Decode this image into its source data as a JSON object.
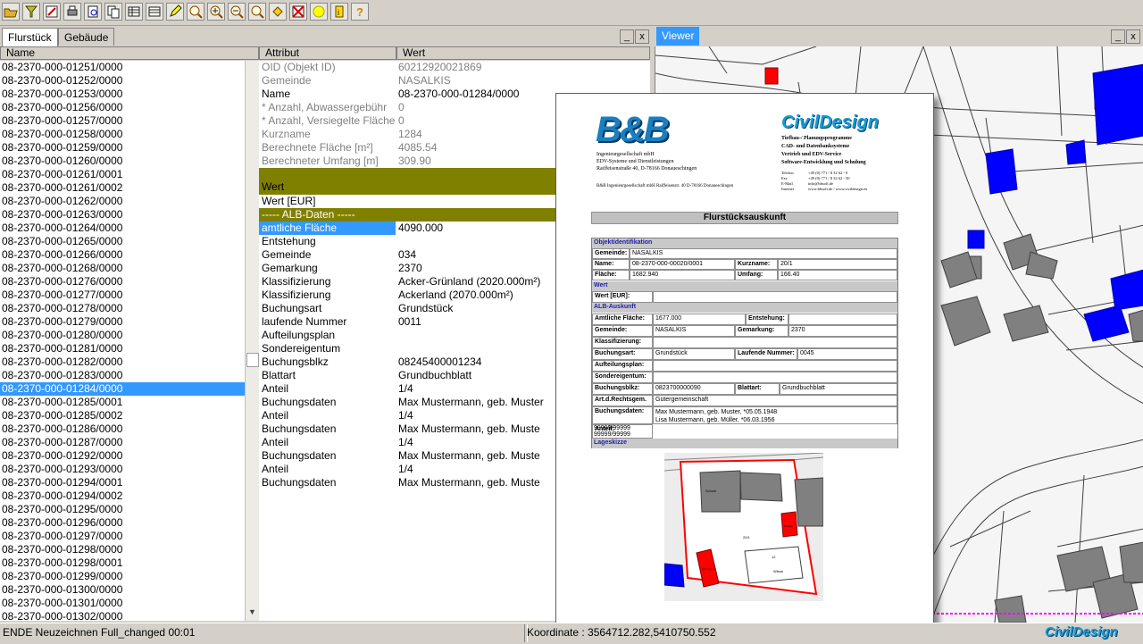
{
  "toolbar": {
    "icons": [
      "open-folder-icon",
      "filter-icon",
      "map-edit-icon",
      "printer-icon",
      "print-preview-icon",
      "copy-icon",
      "table-icon",
      "table-edit-icon",
      "pen-edit-icon",
      "zoom-window-icon",
      "zoom-in-icon",
      "zoom-out-icon",
      "zoom-previous-icon",
      "pan-icon",
      "delete-selection-icon",
      "highlight-icon",
      "info-icon",
      "help-icon"
    ]
  },
  "left_panel": {
    "tabs": [
      "Flurstück",
      "Gebäude"
    ],
    "columns": {
      "name": "Name",
      "attribute": "Attribut",
      "value": "Wert"
    },
    "min_btn": "_",
    "close_btn": "x",
    "items": [
      "08-2370-000-01251/0000",
      "08-2370-000-01252/0000",
      "08-2370-000-01253/0000",
      "08-2370-000-01256/0000",
      "08-2370-000-01257/0000",
      "08-2370-000-01258/0000",
      "08-2370-000-01259/0000",
      "08-2370-000-01260/0000",
      "08-2370-000-01261/0001",
      "08-2370-000-01261/0002",
      "08-2370-000-01262/0000",
      "08-2370-000-01263/0000",
      "08-2370-000-01264/0000",
      "08-2370-000-01265/0000",
      "08-2370-000-01266/0000",
      "08-2370-000-01268/0000",
      "08-2370-000-01276/0000",
      "08-2370-000-01277/0000",
      "08-2370-000-01278/0000",
      "08-2370-000-01279/0000",
      "08-2370-000-01280/0000",
      "08-2370-000-01281/0000",
      "08-2370-000-01282/0000",
      "08-2370-000-01283/0000",
      "08-2370-000-01284/0000",
      "08-2370-000-01285/0001",
      "08-2370-000-01285/0002",
      "08-2370-000-01286/0000",
      "08-2370-000-01287/0000",
      "08-2370-000-01292/0000",
      "08-2370-000-01293/0000",
      "08-2370-000-01294/0001",
      "08-2370-000-01294/0002",
      "08-2370-000-01295/0000",
      "08-2370-000-01296/0000",
      "08-2370-000-01297/0000",
      "08-2370-000-01298/0000",
      "08-2370-000-01298/0001",
      "08-2370-000-01299/0000",
      "08-2370-000-01300/0000",
      "08-2370-000-01301/0000",
      "08-2370-000-01302/0000"
    ],
    "selected_index": 24,
    "attributes": [
      {
        "k": "OID (Objekt ID)",
        "v": "60212920021869",
        "style": "gray"
      },
      {
        "k": "Gemeinde",
        "v": "NASALKIS",
        "style": "gray"
      },
      {
        "k": "Name",
        "v": "08-2370-000-01284/0000",
        "style": ""
      },
      {
        "k": "* Anzahl, Abwassergebühr",
        "v": "0",
        "style": "gray"
      },
      {
        "k": "* Anzahl, Versiegelte Fläche",
        "v": "0",
        "style": "gray"
      },
      {
        "k": "Kurzname",
        "v": "1284",
        "style": "gray"
      },
      {
        "k": "Berechnete Fläche [m²]",
        "v": "4085.54",
        "style": "gray"
      },
      {
        "k": "Berechneter Umfang [m]",
        "v": "309.90",
        "style": "gray"
      },
      {
        "k": "Wert",
        "v": "",
        "style": "olive"
      },
      {
        "k": "Wert [EUR]",
        "v": "",
        "style": ""
      },
      {
        "k": "----- ALB-Daten -----",
        "v": "",
        "style": "section sect2"
      },
      {
        "k": "amtliche Fläche",
        "v": "4090.000",
        "style": "hl"
      },
      {
        "k": "Entstehung",
        "v": "",
        "style": ""
      },
      {
        "k": "Gemeinde",
        "v": "034",
        "style": ""
      },
      {
        "k": "Gemarkung",
        "v": "2370",
        "style": ""
      },
      {
        "k": "Klassifizierung",
        "v": "Acker-Grünland (2020.000m²)",
        "style": ""
      },
      {
        "k": "Klassifizierung",
        "v": "Ackerland (2070.000m²)",
        "style": ""
      },
      {
        "k": "Buchungsart",
        "v": "Grundstück",
        "style": ""
      },
      {
        "k": "laufende Nummer",
        "v": "0011",
        "style": ""
      },
      {
        "k": "Aufteilungsplan",
        "v": "",
        "style": ""
      },
      {
        "k": "Sondereigentum",
        "v": "",
        "style": ""
      },
      {
        "k": "Buchungsblkz",
        "v": "08245400001234",
        "style": ""
      },
      {
        "k": "Blattart",
        "v": "Grundbuchblatt",
        "style": ""
      },
      {
        "k": "Anteil",
        "v": "1/4",
        "style": ""
      },
      {
        "k": "Buchungsdaten",
        "v": "Max Mustermann, geb. Muster",
        "style": ""
      },
      {
        "k": "Anteil",
        "v": "1/4",
        "style": ""
      },
      {
        "k": "Buchungsdaten",
        "v": "Max Mustermann, geb. Muste",
        "style": ""
      },
      {
        "k": "Anteil",
        "v": "1/4",
        "style": ""
      },
      {
        "k": "Buchungsdaten",
        "v": "Max Mustermann, geb. Muste",
        "style": ""
      },
      {
        "k": "Anteil",
        "v": "1/4",
        "style": ""
      },
      {
        "k": "Buchungsdaten",
        "v": "Max Mustermann, geb. Muste",
        "style": ""
      }
    ]
  },
  "viewer": {
    "tab_label": "Viewer",
    "min_btn": "_",
    "close_btn": "x"
  },
  "report": {
    "logo_left": "B&B",
    "company": [
      "Ingenieurgesellschaft mbH",
      "EDV-Systeme und Dienstleistungen",
      "Raiffeisenstraße 40, D-78166 Donaueschingen"
    ],
    "company_small": "B&B Ingenieurgesellschaft mbH Raiffeisenstr. 40 D-78166 Donaueschingen",
    "logo_right": "CivilDesign",
    "services": [
      "Tiefbau-/ Planungsprogramme",
      "CAD- und Datenbanksysteme",
      "Vertrieb und EDV-Service",
      "Software-Entwicklung und Schulung"
    ],
    "contact_labels": [
      "Telefon",
      "Fax",
      "E-Mail",
      "Internet"
    ],
    "contact_values": [
      "+49 (0) 771 / 8 32 62 - 0",
      "+49 (0) 771 / 8 32 62 - 50",
      "info@bbsoft.de",
      "www.bbsoft.de  /  www.civildesign.eu"
    ],
    "title": "Flurstücksauskunft",
    "sec_obj": "Objektidentifikation",
    "gemeinde_l": "Gemeinde:",
    "gemeinde_v": "NASALKIS",
    "name_l": "Name:",
    "name_v": "08-2370-000-00020/0001",
    "kurzname_l": "Kurzname:",
    "kurzname_v": "20/1",
    "flaeche_l": "Fläche:",
    "flaeche_v": "1682.940",
    "umfang_l": "Umfang:",
    "umfang_v": "166.40",
    "sec_wert": "Wert",
    "wert_l": "Wert [EUR]:",
    "sec_alb": "ALB-Auskunft",
    "amtl_l": "Amtliche Fläche:",
    "amtl_v": "1677.000",
    "entst_l": "Entstehung:",
    "gem2_l": "Gemeinde:",
    "gem2_v": "NASALKIS",
    "gemark_l": "Gemarkung:",
    "gemark_v": "2370",
    "klass_l": "Klassifizierung:",
    "buchart_l": "Buchungsart:",
    "buchart_v": "Grundstück",
    "lfdnr_l": "Laufende Nummer:",
    "lfdnr_v": "0045",
    "aufteil_l": "Aufteilungsplan:",
    "sonder_l": "Sondereigentum:",
    "bblkz_l": "Buchungsblkz:",
    "bblkz_v": "0823700000090",
    "blattart_l": "Blattart:",
    "blattart_v": "Grundbuchblatt",
    "artrecht_l": "Art.d.Rechtsgem.",
    "artrecht_v": "Gütergemeinschaft",
    "buchdat_l": "Buchungsdaten:",
    "buchdat_v1": "Max Mustermann, geb. Muster, *05.05.1948",
    "buchdat_v2": "Lisa Mustermann, geb. Müller, *06.03.1956",
    "anteil_l": "Anteil:",
    "anteil_v1": "99999/99999",
    "anteil_v2": "99999/99999",
    "sec_lage": "Lageskizze",
    "sketch_labels": {
      "house1": "Schule",
      "plot": "20/1",
      "label12": "12",
      "wiese": "Wiese",
      "garage": "Garage",
      "schuppen": "Schuppen"
    }
  },
  "status": {
    "left_text": "ENDE Neuzeichnen Full_changed  00:01",
    "coords": "Koordinate : 3564712.282,5410750.552",
    "logo": "CivilDesign"
  },
  "colors": {
    "selection": "#3399ff",
    "olive": "#808000",
    "building_gray": "#808080",
    "building_blue": "#0000ff",
    "parcel_red": "#ff0000"
  }
}
